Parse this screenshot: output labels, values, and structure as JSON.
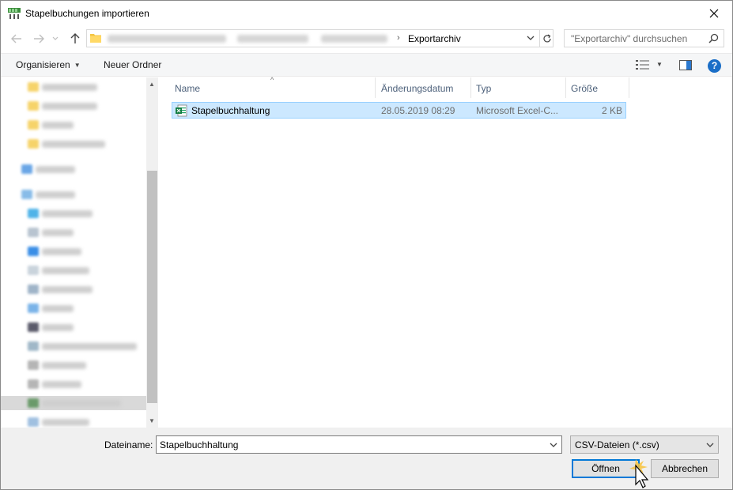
{
  "window": {
    "title": "Stapelbuchungen importieren"
  },
  "navigation": {
    "back_icon": "arrow-left-icon",
    "forward_icon": "arrow-right-icon",
    "recent_icon": "chevron-down-icon",
    "up_icon": "arrow-up-icon"
  },
  "address": {
    "current_folder": "Exportarchiv",
    "separator": "›"
  },
  "search": {
    "placeholder": "\"Exportarchiv\" durchsuchen"
  },
  "toolbar": {
    "organize_label": "Organisieren",
    "new_folder_label": "Neuer Ordner",
    "help_label": "?"
  },
  "file_list": {
    "columns": [
      "Name",
      "Änderungsdatum",
      "Typ",
      "Größe"
    ],
    "rows": [
      {
        "name": "Stapelbuchhaltung",
        "date": "28.05.2019 08:29",
        "type": "Microsoft Excel-C...",
        "size": "2 KB"
      }
    ]
  },
  "footer": {
    "filename_label": "Dateiname:",
    "filename_value": "Stapelbuchhaltung",
    "filter_value": "CSV-Dateien (*.csv)",
    "open_label": "Öffnen",
    "cancel_label": "Abbrechen"
  },
  "colors": {
    "selection": "#cce8ff",
    "selection_border": "#99d1ff",
    "accent": "#0078d7",
    "header_text": "#4c607a"
  }
}
